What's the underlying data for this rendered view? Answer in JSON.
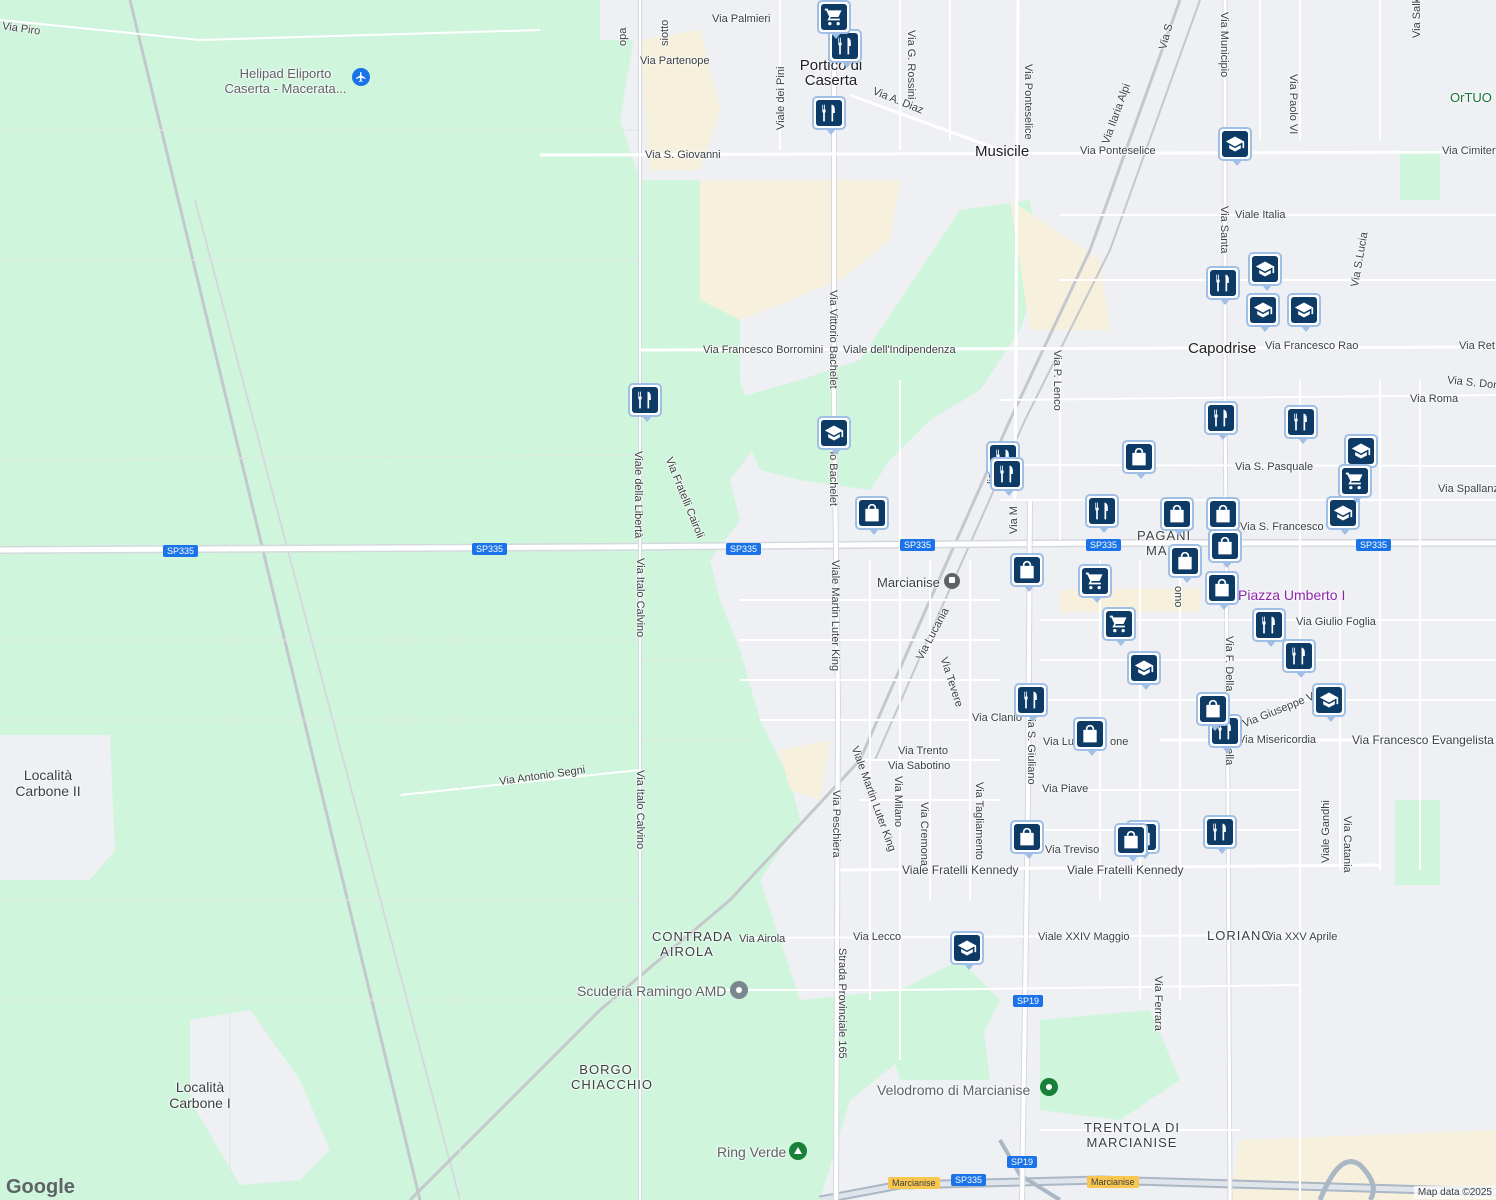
{
  "colors": {
    "green": "#cff5dc",
    "urban": "#eef0f3",
    "sand": "#f6f0dd",
    "road": "#ffffff",
    "road_casing": "#d5d9de",
    "rail": "#c4c8cc",
    "pin_bg": "#0d3b66",
    "pin_border": "#9fbfe6",
    "highway": "#aab7c4"
  },
  "places": {
    "portico": "Portico di Caserta",
    "musicile": "Musicile",
    "capodrise": "Capodrise",
    "marcianise": "Marcianise",
    "pagani_marc": "PAGANI MAR",
    "loriano": "LORIANO",
    "contrada_airola": "CONTRADA AIROLA",
    "borgo_chiacchio": "BORGO CHIACCHIO",
    "trentola": "TRENTOLA DI MARCIANISE",
    "carbone_ii": "Località Carbone II",
    "carbone_i": "Località Carbone I",
    "ortuo": "OrTUO"
  },
  "pois": {
    "helipad": "Helipad Eliporto Caserta - Macerata...",
    "piazza": "Piazza Umberto I",
    "scuderia": "Scuderia Ramingo AMD",
    "velodromo": "Velodromo di Marcianise",
    "ring_verde": "Ring Verde"
  },
  "streets": {
    "via_piro": "Via Piro",
    "via_palmieri": "Via Palmieri",
    "via_partenope": "Via Partenope",
    "via_s_giovanni": "Via S. Giovanni",
    "via_a_diaz": "Via A. Diaz",
    "via_g_rossini": "Via G. Rossini",
    "viale_dei_pini": "Viale dei Pini",
    "via_ponteselice_v": "Via Ponteselice",
    "via_ponteselice_h": "Via Ponteselice",
    "via_ilaria_alpi": "Via Ilaria Alpi",
    "via_municipio": "Via Municipio",
    "via_paolo_vi": "Via Paolo VI",
    "via_cimiter": "Via Cimiter",
    "viale_italia": "Viale Italia",
    "via_santa": "Via Santa",
    "via_s_lucia": "Via S.Lucia",
    "via_f_borromini": "Via Francesco Borromini",
    "viale_indipendenza": "Viale dell'Indipendenza",
    "via_v_bachelet": "Via Vittorio Bachelet",
    "via_v_bachelet2": "rio Bachelet",
    "via_francesco_rao": "Via Francesco Rao",
    "via_ret": "Via Ret",
    "via_s_don": "Via S. Don",
    "via_roma": "Via Roma",
    "via_p_lenco": "Via P. Lenco",
    "via_s_pasquale": "Via S. Pasquale",
    "via_spallanz": "Via Spallanz",
    "via_s_francesco": "Via S. Francesco",
    "viale_della_liberta": "Viale della Libertà",
    "via_fratelli_cairoli": "Via Fratelli Cairoli",
    "via_italo_calvino": "Via Italo Calvino",
    "via_italo_calvino2": "Via Italo Calvino",
    "viale_mlk": "Viale Martin Luter King",
    "viale_mlk2": "Viale Martin Luter King",
    "via_lucania": "Via Lucania",
    "via_tevere": "Via Tevere",
    "via_giulio_foglia": "Via Giulio Foglia",
    "via_giuseppe_verdi": "Via Giuseppe Verdi",
    "via_misericordia": "Via Misericordia",
    "via_f_evangelista": "Via Francesco Evangelista",
    "via_clanio": "Via Clanio",
    "via_s_giuliano": "Via S. Giuliano",
    "via_trento": "Via Trento",
    "via_sabotino": "Via Sabotino",
    "via_antonio_segni": "Via Antonio Segni",
    "via_peschiera": "Via Peschiera",
    "via_milano": "Via Milano",
    "via_cremona": "Via Cremona",
    "via_tagliamento": "Via Tagliamento",
    "via_piave": "Via Piave",
    "via_treviso": "Via Treviso",
    "viale_f_kennedy": "Viale Fratelli Kennedy",
    "viale_f_kennedy2": "Viale Fratelli Kennedy",
    "via_gandhi": "Viale Gandhi",
    "via_catania": "Via Catania",
    "via_airola": "Via Airola",
    "via_lecco": "Via Lecco",
    "viale_xxiv_maggio": "Viale XXIV Maggio",
    "via_xxv_aprile": "Via XXV Aprile",
    "via_ferrara": "Via Ferrara",
    "strada_prov_165": "Strada Provinciale 165",
    "via_f_della": "Via F. Della",
    "via_della": "della",
    "via_lu_one": "Via Lu",
    "one": "one",
    "via_salk": "Via Salk",
    "mente": "nte",
    "uomo": "omo",
    "via_ma": "Via M",
    "via_lica": "lica",
    "via_s": "Via S",
    "via_pa": "opa",
    "via_siotto": "siotto"
  },
  "shields": {
    "sp335": "SP335",
    "sp19": "SP19",
    "marcianise_exit": "Marcianise"
  },
  "branding": {
    "google": "Google",
    "map_data": "Map data ©2025"
  },
  "icons": {
    "restaurant": "restaurant-icon",
    "school": "school-icon",
    "shopping": "shopping-bag-icon",
    "cart": "cart-icon",
    "airport": "airport-icon",
    "train": "train-station-icon",
    "park": "park-icon",
    "place": "place-icon"
  }
}
